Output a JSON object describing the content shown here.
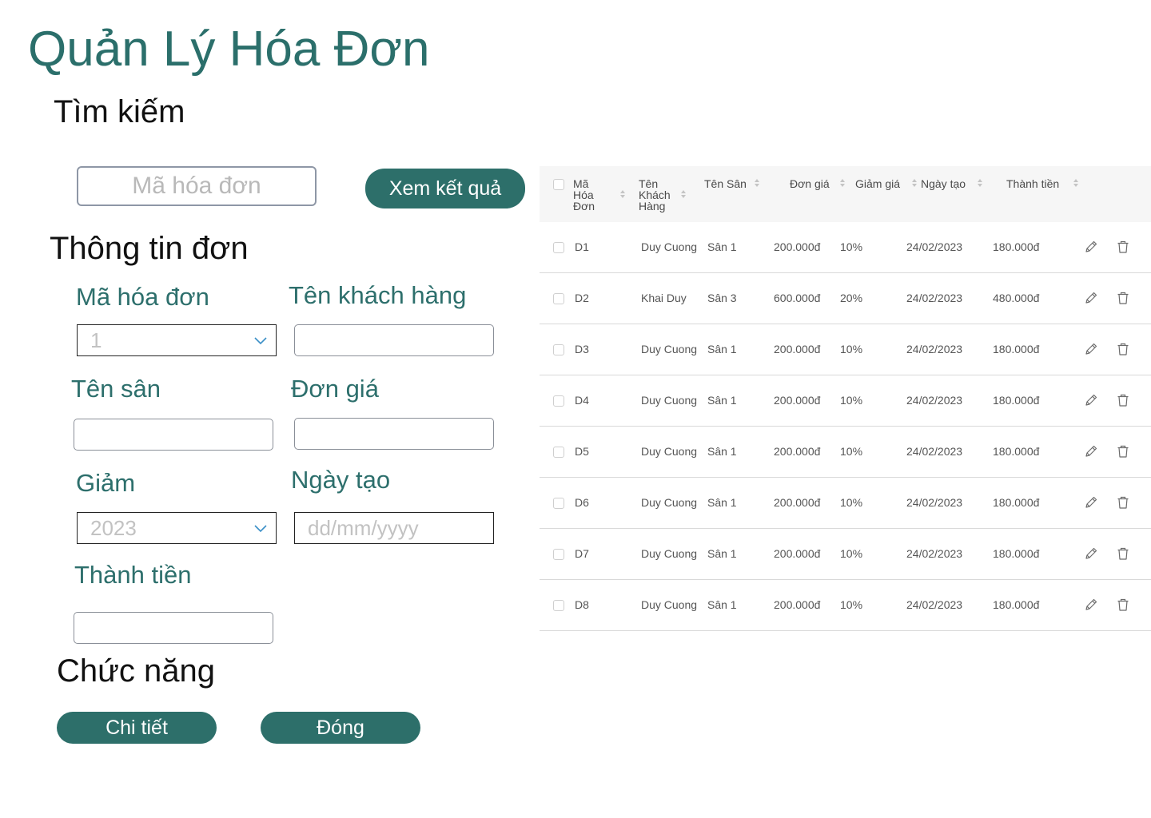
{
  "app": {
    "title": "Quản Lý Hóa Đơn"
  },
  "search": {
    "heading": "Tìm kiếm",
    "placeholder": "Mã hóa đơn",
    "button_label": "Xem kết quả"
  },
  "form": {
    "heading": "Thông tin đơn",
    "invoice_code": {
      "label": "Mã hóa đơn",
      "value": "1"
    },
    "customer_name": {
      "label": "Tên khách hàng",
      "value": ""
    },
    "field_name": {
      "label": "Tên sân",
      "value": ""
    },
    "unit_price": {
      "label": "Đơn giá",
      "value": ""
    },
    "discount": {
      "label": "Giảm",
      "value": "2023"
    },
    "created_date": {
      "label": "Ngày tạo",
      "placeholder": "dd/mm/yyyy"
    },
    "total": {
      "label": "Thành tiền",
      "value": ""
    }
  },
  "functions": {
    "heading": "Chức năng",
    "detail_label": "Chi tiết",
    "close_label": "Đóng"
  },
  "table": {
    "columns": {
      "code": "Mã\nHóa\nĐơn",
      "customer": "Tên\nKhách\nHàng",
      "field": "Tên Sân",
      "price": "Đơn giá",
      "discount": "Giảm giá",
      "date": "Ngày tạo",
      "total": "Thành tiền"
    },
    "rows": [
      {
        "code": "D1",
        "customer": "Duy Cuong",
        "field": "Sân 1",
        "price": "200.000đ",
        "discount": "10%",
        "date": "24/02/2023",
        "total": "180.000đ"
      },
      {
        "code": "D2",
        "customer": "Khai Duy",
        "field": "Sân 3",
        "price": "600.000đ",
        "discount": "20%",
        "date": "24/02/2023",
        "total": "480.000đ"
      },
      {
        "code": "D3",
        "customer": "Duy Cuong",
        "field": "Sân 1",
        "price": "200.000đ",
        "discount": "10%",
        "date": "24/02/2023",
        "total": "180.000đ"
      },
      {
        "code": "D4",
        "customer": "Duy Cuong",
        "field": "Sân 1",
        "price": "200.000đ",
        "discount": "10%",
        "date": "24/02/2023",
        "total": "180.000đ"
      },
      {
        "code": "D5",
        "customer": "Duy Cuong",
        "field": "Sân 1",
        "price": "200.000đ",
        "discount": "10%",
        "date": "24/02/2023",
        "total": "180.000đ"
      },
      {
        "code": "D6",
        "customer": "Duy Cuong",
        "field": "Sân 1",
        "price": "200.000đ",
        "discount": "10%",
        "date": "24/02/2023",
        "total": "180.000đ"
      },
      {
        "code": "D7",
        "customer": "Duy Cuong",
        "field": "Sân 1",
        "price": "200.000đ",
        "discount": "10%",
        "date": "24/02/2023",
        "total": "180.000đ"
      },
      {
        "code": "D8",
        "customer": "Duy Cuong",
        "field": "Sân 1",
        "price": "200.000đ",
        "discount": "10%",
        "date": "24/02/2023",
        "total": "180.000đ"
      }
    ],
    "row_icons": [
      "pencil-icon",
      "trash-icon"
    ]
  },
  "colors": {
    "accent": "#2d6f6a",
    "label": "#2d6f6c",
    "header_bg": "#f6f6f6"
  }
}
